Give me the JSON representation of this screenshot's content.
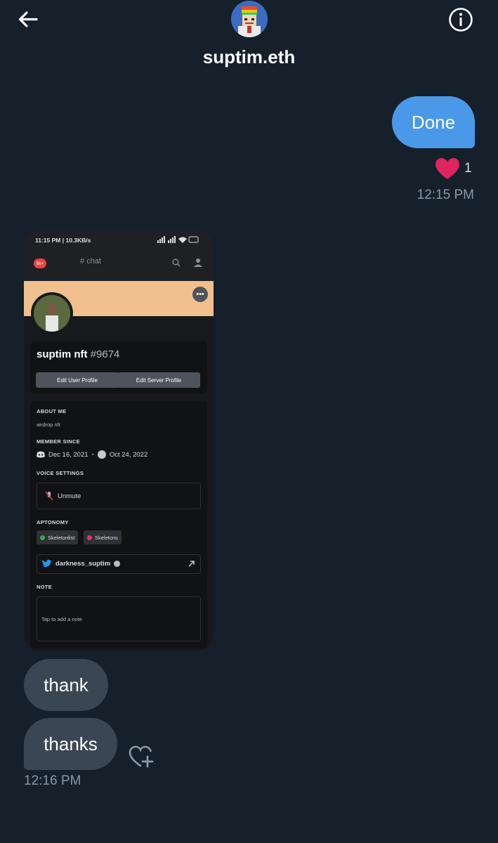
{
  "header": {
    "username": "suptim.eth",
    "back_icon": "arrow-left-icon",
    "info_icon": "info-icon"
  },
  "messages": {
    "sent": {
      "text": "Done",
      "reaction_icon": "heart-icon",
      "reaction_count": "1",
      "timestamp": "12:15 PM"
    },
    "received": [
      {
        "text": "thank"
      },
      {
        "text": "thanks"
      }
    ],
    "received_timestamp": "12:16 PM",
    "add_reaction_icon": "heart-plus-icon"
  },
  "screenshot": {
    "status_time": "11:15 PM | 10.3KB/s",
    "channel": "chat",
    "server_badge": "5k+",
    "username": "suptim nft",
    "discriminator": "#9674",
    "edit_user_profile": "Edit User Profile",
    "edit_server_profile": "Edit Server Profile",
    "about_me_label": "ABOUT ME",
    "about_me": "airdrop nft",
    "member_since_label": "MEMBER SINCE",
    "member_since_discord": "Dec 16, 2021",
    "member_since_server": "Oct 24, 2022",
    "voice_settings_label": "VOICE SETTINGS",
    "unmute": "Unmute",
    "roles_label": "APTONOMY",
    "roles": [
      {
        "name": "Skeletonlist",
        "color": "#3ba55c"
      },
      {
        "name": "Skeletons",
        "color": "#e2336b"
      }
    ],
    "twitter_handle": "darkness_suptim",
    "note_label": "NOTE",
    "note_placeholder": "Tap to add a note"
  },
  "colors": {
    "background": "#15202b",
    "sent_bubble": "#4a99e9",
    "received_bubble": "#3a4753",
    "reaction_heart": "#e0245e",
    "timestamp": "#8b98a5",
    "banner": "#f0c08e"
  }
}
